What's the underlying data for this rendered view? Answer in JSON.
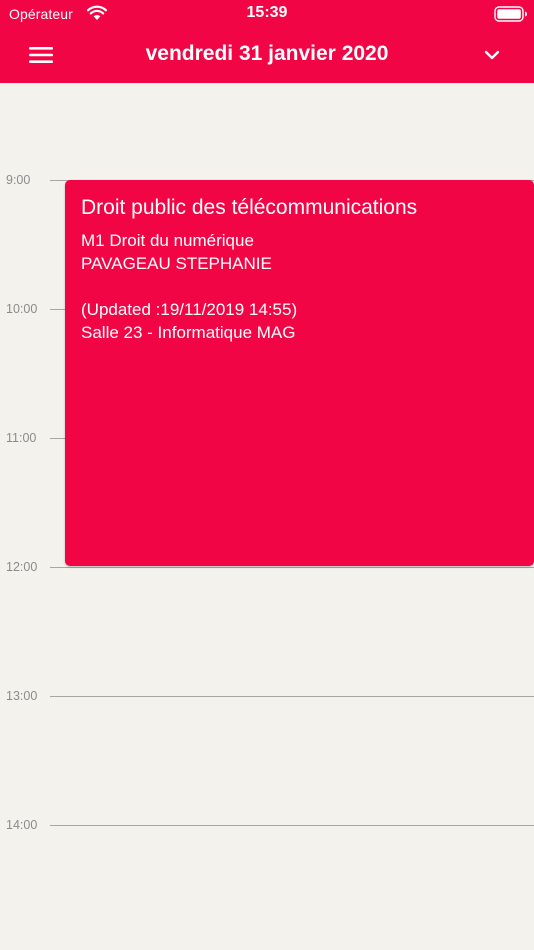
{
  "status_bar": {
    "carrier": "Opérateur",
    "time": "15:39",
    "wifi_icon": "wifi-icon",
    "battery_icon": "battery-icon"
  },
  "nav": {
    "menu_icon": "hamburger-menu-icon",
    "date_title": "vendredi 31 janvier 2020",
    "chevron_icon": "chevron-down-icon"
  },
  "timeline": {
    "hours": [
      "9:00",
      "10:00",
      "11:00",
      "12:00",
      "13:00",
      "14:00"
    ]
  },
  "event": {
    "title": "Droit public des télécommunications",
    "course": "M1 Droit du numérique",
    "teacher": "PAVAGEAU STEPHANIE",
    "updated": "(Updated :19/11/2019 14:55)",
    "room": "Salle 23 - Informatique MAG",
    "start": "9:00",
    "end": "12:00",
    "color": "#f20544"
  },
  "colors": {
    "accent": "#f20544",
    "background": "#f4f2ed",
    "gridline": "#a7a7a7",
    "hour_label": "#8b8b8b"
  }
}
